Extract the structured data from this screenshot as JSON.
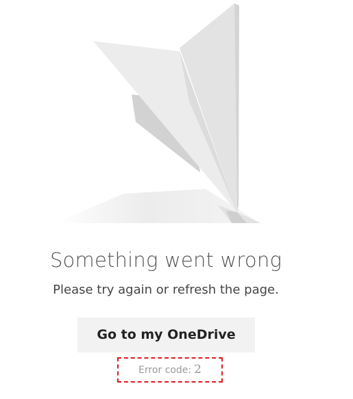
{
  "error_page": {
    "headline": "Something went wrong",
    "message": "Please try again or refresh the page.",
    "button_label": "Go to my OneDrive",
    "error_label": "Error code:",
    "error_code": "2"
  },
  "illustration": {
    "name": "paper-airplane",
    "colors": {
      "light_face": "#ececec",
      "mid_face": "#dcdcdc",
      "dark_face": "#c8c8c8",
      "shadow": "#eeeeee"
    }
  },
  "colors": {
    "background": "#ffffff",
    "button_background": "#f2f2f2",
    "highlight_border": "#e0191f",
    "muted_text": "#9a9a9a"
  }
}
